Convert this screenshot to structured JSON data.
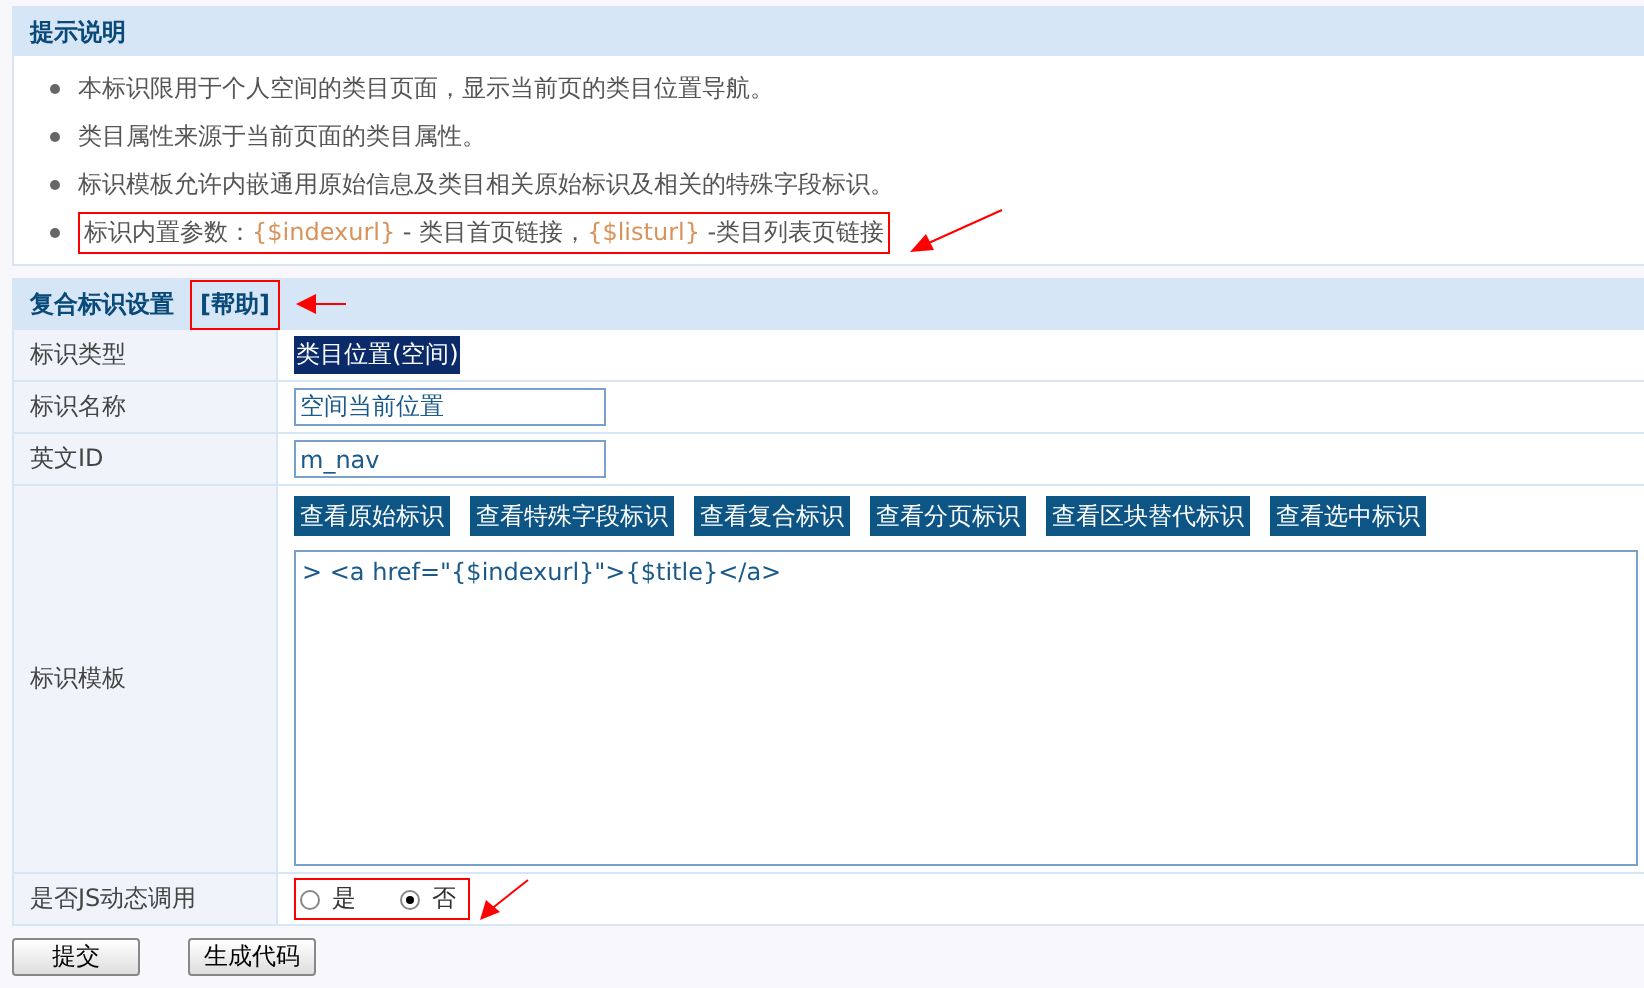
{
  "tips": {
    "title": "提示说明",
    "items": [
      {
        "highlighted": false,
        "parts": [
          {
            "kind": "text",
            "text": "本标识限用于个人空间的类目页面，显示当前页的类目位置导航。"
          }
        ]
      },
      {
        "highlighted": false,
        "parts": [
          {
            "kind": "text",
            "text": "类目属性来源于当前页面的类目属性。"
          }
        ]
      },
      {
        "highlighted": false,
        "parts": [
          {
            "kind": "text",
            "text": "标识模板允许内嵌通用原始信息及类目相关原始标识及相关的特殊字段标识。"
          }
        ]
      },
      {
        "highlighted": true,
        "parts": [
          {
            "kind": "text",
            "text": "标识内置参数："
          },
          {
            "kind": "code",
            "text": "{$indexurl}"
          },
          {
            "kind": "text",
            "text": " - 类目首页链接，"
          },
          {
            "kind": "code",
            "text": "{$listurl}"
          },
          {
            "kind": "text",
            "text": " -类目列表页链接"
          }
        ]
      }
    ]
  },
  "settings": {
    "title": "复合标识设置",
    "help": "[帮助]",
    "type_label": "标识类型",
    "type_value": {
      "text": "类目位置(空间)",
      "selected": true
    },
    "name_label": "标识名称",
    "name_value": "空间当前位置",
    "id_label": "英文ID",
    "id_value": "m_nav",
    "template_label": "标识模板",
    "view_buttons": [
      "查看原始标识",
      "查看特殊字段标识",
      "查看复合标识",
      "查看分页标识",
      "查看区块替代标识",
      "查看选中标识"
    ],
    "template_value": "> <a href=\"{$indexurl}\">{$title}</a>",
    "js_label": "是否JS动态调用",
    "js_options": [
      {
        "label": "是",
        "selected": false
      },
      {
        "label": "否",
        "selected": true
      }
    ]
  },
  "actions": [
    "提交",
    "生成代码"
  ]
}
